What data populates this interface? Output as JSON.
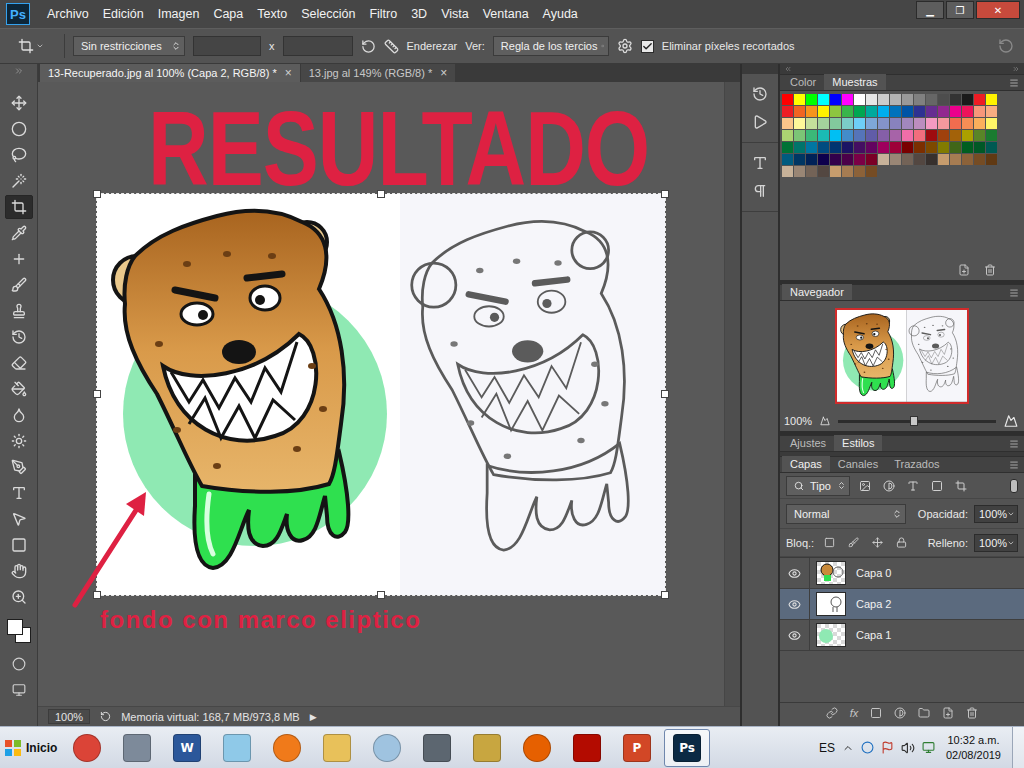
{
  "app": {
    "logo": "Ps"
  },
  "menu": [
    "Archivo",
    "Edición",
    "Imagen",
    "Capa",
    "Texto",
    "Selección",
    "Filtro",
    "3D",
    "Vista",
    "Ventana",
    "Ayuda"
  ],
  "window_controls": [
    "▁",
    "❐",
    "✕"
  ],
  "options_bar": {
    "ratio": "Sin restricciones",
    "times": "x",
    "straighten": "Enderezar",
    "view_label": "Ver:",
    "view": "Regla de los tercios",
    "delete_cropped": {
      "label": "Eliminar píxeles recortados",
      "checked": true
    }
  },
  "document_tabs": [
    {
      "label": "13-Recuperado.jpg al 100% (Capa 2, RGB/8) *",
      "close": "×",
      "selected": true
    },
    {
      "label": "13.jpg al 149% (RGB/8) *",
      "close": "×",
      "selected": false
    }
  ],
  "tools": [
    {
      "kind": "move",
      "selected": false
    },
    {
      "kind": "ellipse",
      "selected": false
    },
    {
      "kind": "lasso",
      "selected": false
    },
    {
      "kind": "wand",
      "selected": false
    },
    {
      "kind": "crop",
      "selected": true
    },
    {
      "kind": "eyedropper",
      "selected": false
    },
    {
      "kind": "healing",
      "selected": false
    },
    {
      "kind": "brush",
      "selected": false
    },
    {
      "kind": "stamp",
      "selected": false
    },
    {
      "kind": "history",
      "selected": false
    },
    {
      "kind": "eraser",
      "selected": false
    },
    {
      "kind": "bucket",
      "selected": false
    },
    {
      "kind": "blur",
      "selected": false
    },
    {
      "kind": "dodge",
      "selected": false
    },
    {
      "kind": "pen",
      "selected": false
    },
    {
      "kind": "type",
      "selected": false
    },
    {
      "kind": "path",
      "selected": false
    },
    {
      "kind": "rectangle",
      "selected": false
    },
    {
      "kind": "hand",
      "selected": false
    },
    {
      "kind": "zoom",
      "selected": false
    }
  ],
  "annotations": {
    "title": "RESULTADO",
    "note": "fondo con marco eliptico"
  },
  "status_bar": {
    "zoom": "100%",
    "info": "Memoria virtual: 168,7 MB/973,8 MB",
    "arrow": "▶"
  },
  "side_icons": [
    {
      "kind": "history"
    },
    {
      "kind": "play"
    },
    {
      "kind": "character"
    },
    {
      "kind": "paragraph"
    }
  ],
  "swatches_panel": {
    "tabs": [
      {
        "label": "Color",
        "selected": false
      },
      {
        "label": "Muestras",
        "selected": true
      }
    ],
    "swatches": [
      "#ff0000",
      "#ffff00",
      "#00ff00",
      "#00ffff",
      "#0000ff",
      "#ff00ff",
      "#ffffff",
      "#e6e6e6",
      "#cccccc",
      "#b3b3b3",
      "#999999",
      "#808080",
      "#666666",
      "#4d4d4d",
      "#333333",
      "#1a1a1a",
      "#ed1c24",
      "#fff200",
      "#ed1c24",
      "#f26522",
      "#f7941d",
      "#fff200",
      "#8dc63f",
      "#39b54a",
      "#00a651",
      "#00a99d",
      "#00aeef",
      "#0072bc",
      "#0054a6",
      "#2e3192",
      "#662d91",
      "#92278f",
      "#ec008c",
      "#ed145b",
      "#f7977a",
      "#f9ad81",
      "#fdc68a",
      "#fff79a",
      "#c4df9b",
      "#a3d39c",
      "#82ca9d",
      "#7bcdc8",
      "#6ecff6",
      "#7ea7d8",
      "#8493ca",
      "#8882be",
      "#a187be",
      "#bc8dbf",
      "#f49ac2",
      "#f6989d",
      "#f26c4f",
      "#f68e55",
      "#fbaf5c",
      "#fff467",
      "#acd372",
      "#7cc576",
      "#3bb878",
      "#1abbb4",
      "#00bff3",
      "#438cca",
      "#5574b9",
      "#605ca8",
      "#855fa8",
      "#a763a8",
      "#f06ea9",
      "#f26d7d",
      "#9e0b0f",
      "#a0410d",
      "#a36209",
      "#aba000",
      "#598527",
      "#1a7b30",
      "#007236",
      "#00746b",
      "#0076a3",
      "#004b80",
      "#003471",
      "#1b1464",
      "#440e62",
      "#630460",
      "#9e005d",
      "#9e0039",
      "#790000",
      "#7b2e00",
      "#7d4900",
      "#827b00",
      "#406618",
      "#005e20",
      "#005826",
      "#005952",
      "#005b7f",
      "#003663",
      "#002157",
      "#0d004c",
      "#32004b",
      "#4b0049",
      "#7b0046",
      "#7a0026",
      "#c7b299",
      "#998675",
      "#736357",
      "#534741",
      "#37302d",
      "#c69c6d",
      "#a67c52",
      "#8c6239",
      "#754c24",
      "#603913",
      "#c7b299",
      "#998675",
      "#736357",
      "#534741",
      "#c69c6d",
      "#a67c52",
      "#8c6239",
      "#754c24"
    ]
  },
  "navigator": {
    "title": "Navegador",
    "zoom": "100%",
    "zoom_level": 0.48
  },
  "layers_panel": {
    "top_tabs": [
      {
        "label": "Ajustes",
        "selected": false
      },
      {
        "label": "Estilos",
        "selected": true
      }
    ],
    "tabs": [
      {
        "label": "Capas",
        "selected": true
      },
      {
        "label": "Canales",
        "selected": false
      },
      {
        "label": "Trazados",
        "selected": false
      }
    ],
    "filter": "Tipo",
    "blend_mode": "Normal",
    "opacity_label": "Opacidad:",
    "opacity": "100%",
    "lock_label": "Bloq.:",
    "fill_label": "Relleno:",
    "fill": "100%",
    "fx_label": "fx",
    "layers": [
      {
        "name": "Capa 0",
        "kind": "art",
        "visible": true,
        "selected": false
      },
      {
        "name": "Capa 2",
        "kind": "sketch",
        "visible": true,
        "selected": true
      },
      {
        "name": "Capa 1",
        "kind": "circle",
        "visible": true,
        "selected": false
      }
    ]
  },
  "taskbar": {
    "start": "Inicio",
    "apps": [
      {
        "kind": "chrome",
        "color": "#db4437",
        "glyph": "",
        "selected": false
      },
      {
        "kind": "calculator",
        "color": "#7d8a9a",
        "glyph": "",
        "selected": false
      },
      {
        "kind": "word",
        "color": "#2b579a",
        "glyph": "W",
        "selected": false
      },
      {
        "kind": "notes",
        "color": "#8fc9e8",
        "glyph": "",
        "selected": false
      },
      {
        "kind": "media",
        "color": "#f07a1a",
        "glyph": "",
        "selected": false
      },
      {
        "kind": "explorer",
        "color": "#e8c15a",
        "glyph": "",
        "selected": false
      },
      {
        "kind": "paint",
        "color": "#9fc3e0",
        "glyph": "",
        "selected": false
      },
      {
        "kind": "scanner",
        "color": "#5c6670",
        "glyph": "",
        "selected": false
      },
      {
        "kind": "archive",
        "color": "#c8a640",
        "glyph": "",
        "selected": false
      },
      {
        "kind": "firefox",
        "color": "#e66000",
        "glyph": "",
        "selected": false
      },
      {
        "kind": "pdf",
        "color": "#b30b00",
        "glyph": "",
        "selected": false
      },
      {
        "kind": "powerpoint",
        "color": "#d24726",
        "glyph": "P",
        "selected": false
      },
      {
        "kind": "photoshop",
        "color": "#0b2a44",
        "glyph": "Ps",
        "selected": true
      }
    ],
    "language": "ES",
    "time": "10:32 a.m.",
    "date": "02/08/2019"
  }
}
